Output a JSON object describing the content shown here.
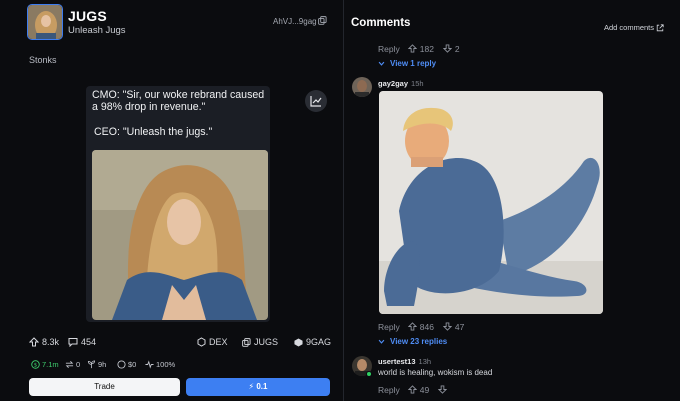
{
  "token": {
    "name": "JUGS",
    "tagline": "Unleash Jugs",
    "address": "AhVJ...9gag",
    "section_label": "Stonks"
  },
  "meme": {
    "line1": "CMO: \"Sir, our woke rebrand caused a 98% drop in revenue.\"",
    "line2": "CEO: \"Unleash the jugs.\""
  },
  "stats": {
    "upvotes": "8.3k",
    "comments": "454",
    "dex": "DEX",
    "ticker": "JUGS",
    "source": "9GAG"
  },
  "meta": {
    "market_cap": "7.1m",
    "trades": "0",
    "age": "9h",
    "volume": "$0",
    "percent": "100%"
  },
  "actions": {
    "trade_label": "Trade",
    "buy_label": "0.1"
  },
  "comments": {
    "title": "Comments",
    "add_label": "Add comments",
    "top_reply": {
      "label": "Reply",
      "up": "182",
      "down": "2",
      "view": "View 1 reply"
    },
    "items": [
      {
        "user": "gay2gay",
        "time": "15h",
        "reply": "Reply",
        "up": "846",
        "down": "47",
        "view": "View 23 replies"
      },
      {
        "user": "usertest13",
        "time": "13h",
        "text": "world is healing, wokism is dead",
        "reply": "Reply",
        "up": "49"
      }
    ]
  },
  "colors": {
    "accent": "#3d7ff2",
    "link": "#4f8df5",
    "positive": "#3ecf6e",
    "panel": "#0b0c0f"
  }
}
